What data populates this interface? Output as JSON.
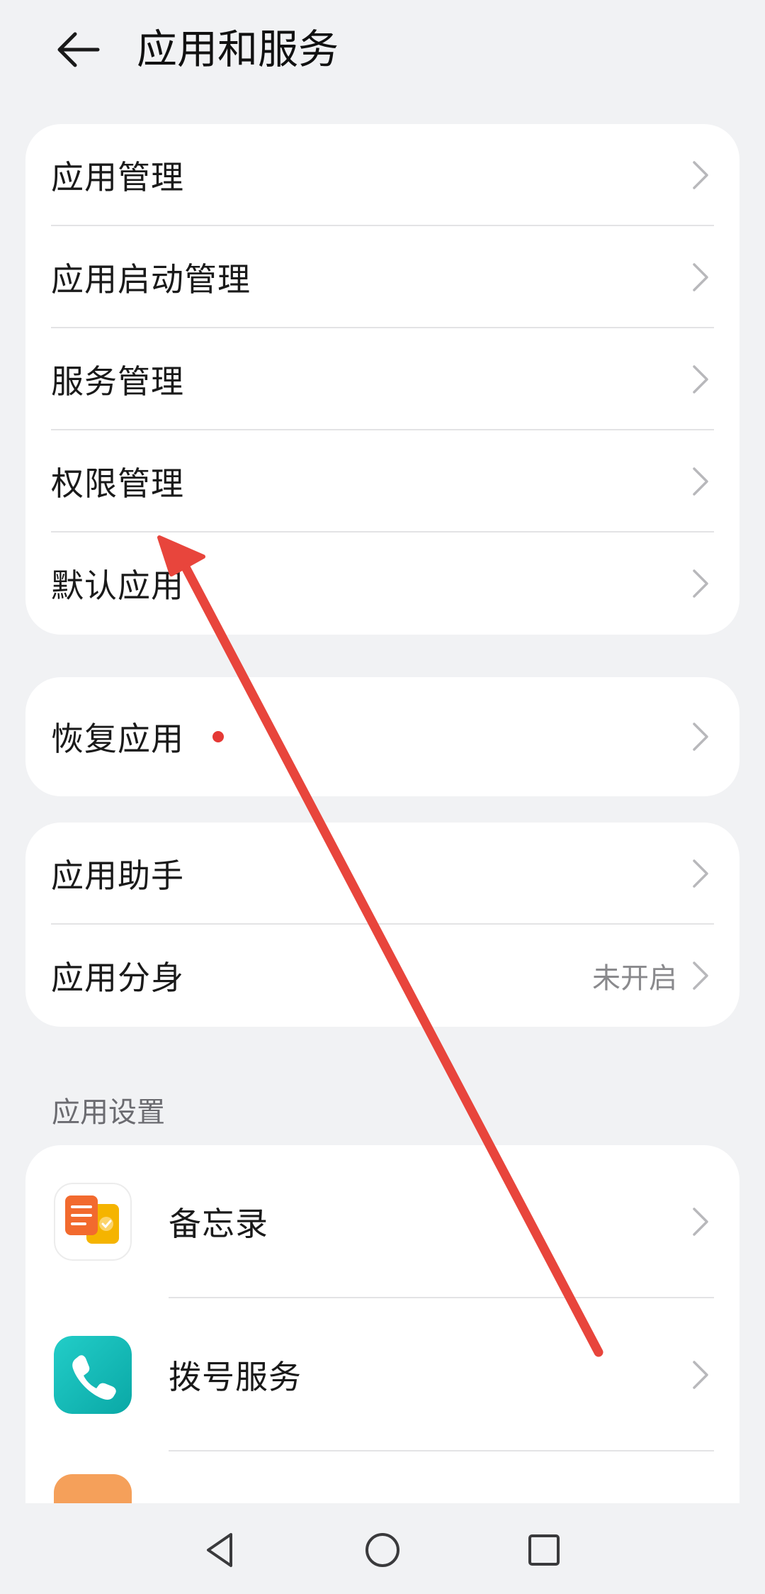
{
  "header": {
    "title": "应用和服务"
  },
  "group1": [
    {
      "label": "应用管理"
    },
    {
      "label": "应用启动管理"
    },
    {
      "label": "服务管理"
    },
    {
      "label": "权限管理"
    },
    {
      "label": "默认应用"
    }
  ],
  "group2": [
    {
      "label": "恢复应用"
    }
  ],
  "group3": [
    {
      "label": "应用助手"
    },
    {
      "label": "应用分身",
      "value": "未开启"
    }
  ],
  "app_settings": {
    "title": "应用设置",
    "items": [
      {
        "label": "备忘录",
        "icon": "memo-app-icon"
      },
      {
        "label": "拨号服务",
        "icon": "phone-app-icon"
      }
    ]
  },
  "colors": {
    "background": "#f1f2f4",
    "card": "#ffffff",
    "badge": "#e53935",
    "annotation_arrow": "#e8453c"
  }
}
